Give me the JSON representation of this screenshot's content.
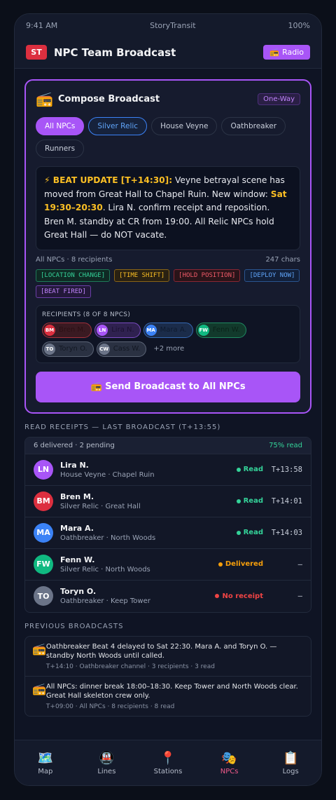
{
  "status_bar": {
    "time": "9:41 AM",
    "carrier": "StoryTransit",
    "battery": "100%"
  },
  "header": {
    "logo": "ST",
    "title": "NPC Team Broadcast",
    "radio_icon": "radio-icon",
    "radio_label": "Radio"
  },
  "compose": {
    "icon": "radio-icon",
    "title": "Compose Broadcast",
    "badge": "One-Way",
    "channels": [
      {
        "label": "All NPCs",
        "state": "active"
      },
      {
        "label": "Silver Relic",
        "state": "selected"
      },
      {
        "label": "House Veyne",
        "state": "normal"
      },
      {
        "label": "Oathbreaker",
        "state": "normal"
      },
      {
        "label": "Runners",
        "state": "normal"
      }
    ],
    "message": {
      "part1": "⚡ BEAT UPDATE [T+14:30]:",
      "part2": " Veyne betrayal scene has moved from Great Hall to Chapel Ruin. New window: ",
      "part3": "Sat 19:30–20:30",
      "part4": ". Lira N. confirm receipt and reposition. Bren M. standby at CR from 19:00. All Relic NPCs hold Great Hall — do NOT vacate."
    },
    "recipients_summary": "All NPCs · 8 recipients",
    "char_count": "247 chars",
    "tags": [
      {
        "label": "[LOCATION CHANGE]",
        "color": "green"
      },
      {
        "label": "[TIME SHIFT]",
        "color": "amber"
      },
      {
        "label": "[HOLD POSITION]",
        "color": "red"
      },
      {
        "label": "[DEPLOY NOW]",
        "color": "blue"
      },
      {
        "label": "[BEAT FIRED]",
        "color": "purple"
      }
    ],
    "recipients_title": "RECIPIENTS (8 OF 8 NPCS)",
    "recipients": [
      {
        "initials": "BM",
        "name": "Bren M.",
        "color": "red"
      },
      {
        "initials": "LN",
        "name": "Lira N.",
        "color": "purple"
      },
      {
        "initials": "MA",
        "name": "Mara A.",
        "color": "blue"
      },
      {
        "initials": "FW",
        "name": "Fenn W.",
        "color": "green"
      },
      {
        "initials": "TO",
        "name": "Toryn O.",
        "color": "gray"
      },
      {
        "initials": "CW",
        "name": "Cass W.",
        "color": "gray"
      }
    ],
    "more": "+2 more",
    "send_label": "📻 Send Broadcast to All NPCs"
  },
  "receipts": {
    "title": "READ RECEIPTS — LAST BROADCAST (T+13:55)",
    "summary": "6 delivered · 2 pending",
    "percent": "75% read",
    "rows": [
      {
        "initials": "LN",
        "color": "#a855f7",
        "name": "Lira N.",
        "sub": "House Veyne · Chapel Ruin",
        "status": "Read",
        "kind": "read",
        "time": "T+13:58"
      },
      {
        "initials": "BM",
        "color": "#dc2f3f",
        "name": "Bren M.",
        "sub": "Silver Relic · Great Hall",
        "status": "Read",
        "kind": "read",
        "time": "T+14:01"
      },
      {
        "initials": "MA",
        "color": "#3b82f6",
        "name": "Mara A.",
        "sub": "Oathbreaker · North Woods",
        "status": "Read",
        "kind": "read",
        "time": "T+14:03"
      },
      {
        "initials": "FW",
        "color": "#10b981",
        "name": "Fenn W.",
        "sub": "Silver Relic · North Woods",
        "status": "Delivered",
        "kind": "del",
        "time": "–"
      },
      {
        "initials": "TO",
        "color": "#6b7488",
        "name": "Toryn O.",
        "sub": "Oathbreaker · Keep Tower",
        "status": "No receipt",
        "kind": "no",
        "time": "–"
      }
    ]
  },
  "previous": {
    "title": "PREVIOUS BROADCASTS",
    "items": [
      {
        "icon": "radio-icon",
        "text": "Oathbreaker Beat 4 delayed to Sat 22:30. Mara A. and Toryn O. — standby North Woods until called.",
        "meta": "T+14:10 · Oathbreaker channel · 3 recipients · 3 read"
      },
      {
        "icon": "radio-icon",
        "text": "All NPCs: dinner break 18:00–18:30. Keep Tower and North Woods clear. Great Hall skeleton crew only.",
        "meta": "T+09:00 · All NPCs · 8 recipients · 8 read"
      }
    ]
  },
  "tabs": [
    {
      "icon": "map-icon",
      "glyph": "🗺️",
      "label": "Map",
      "active": false
    },
    {
      "icon": "train-icon",
      "glyph": "🚇",
      "label": "Lines",
      "active": false
    },
    {
      "icon": "pin-icon",
      "glyph": "📍",
      "label": "Stations",
      "active": false
    },
    {
      "icon": "masks-icon",
      "glyph": "🎭",
      "label": "NPCs",
      "active": true
    },
    {
      "icon": "clipboard-icon",
      "glyph": "📋",
      "label": "Logs",
      "active": false
    }
  ]
}
